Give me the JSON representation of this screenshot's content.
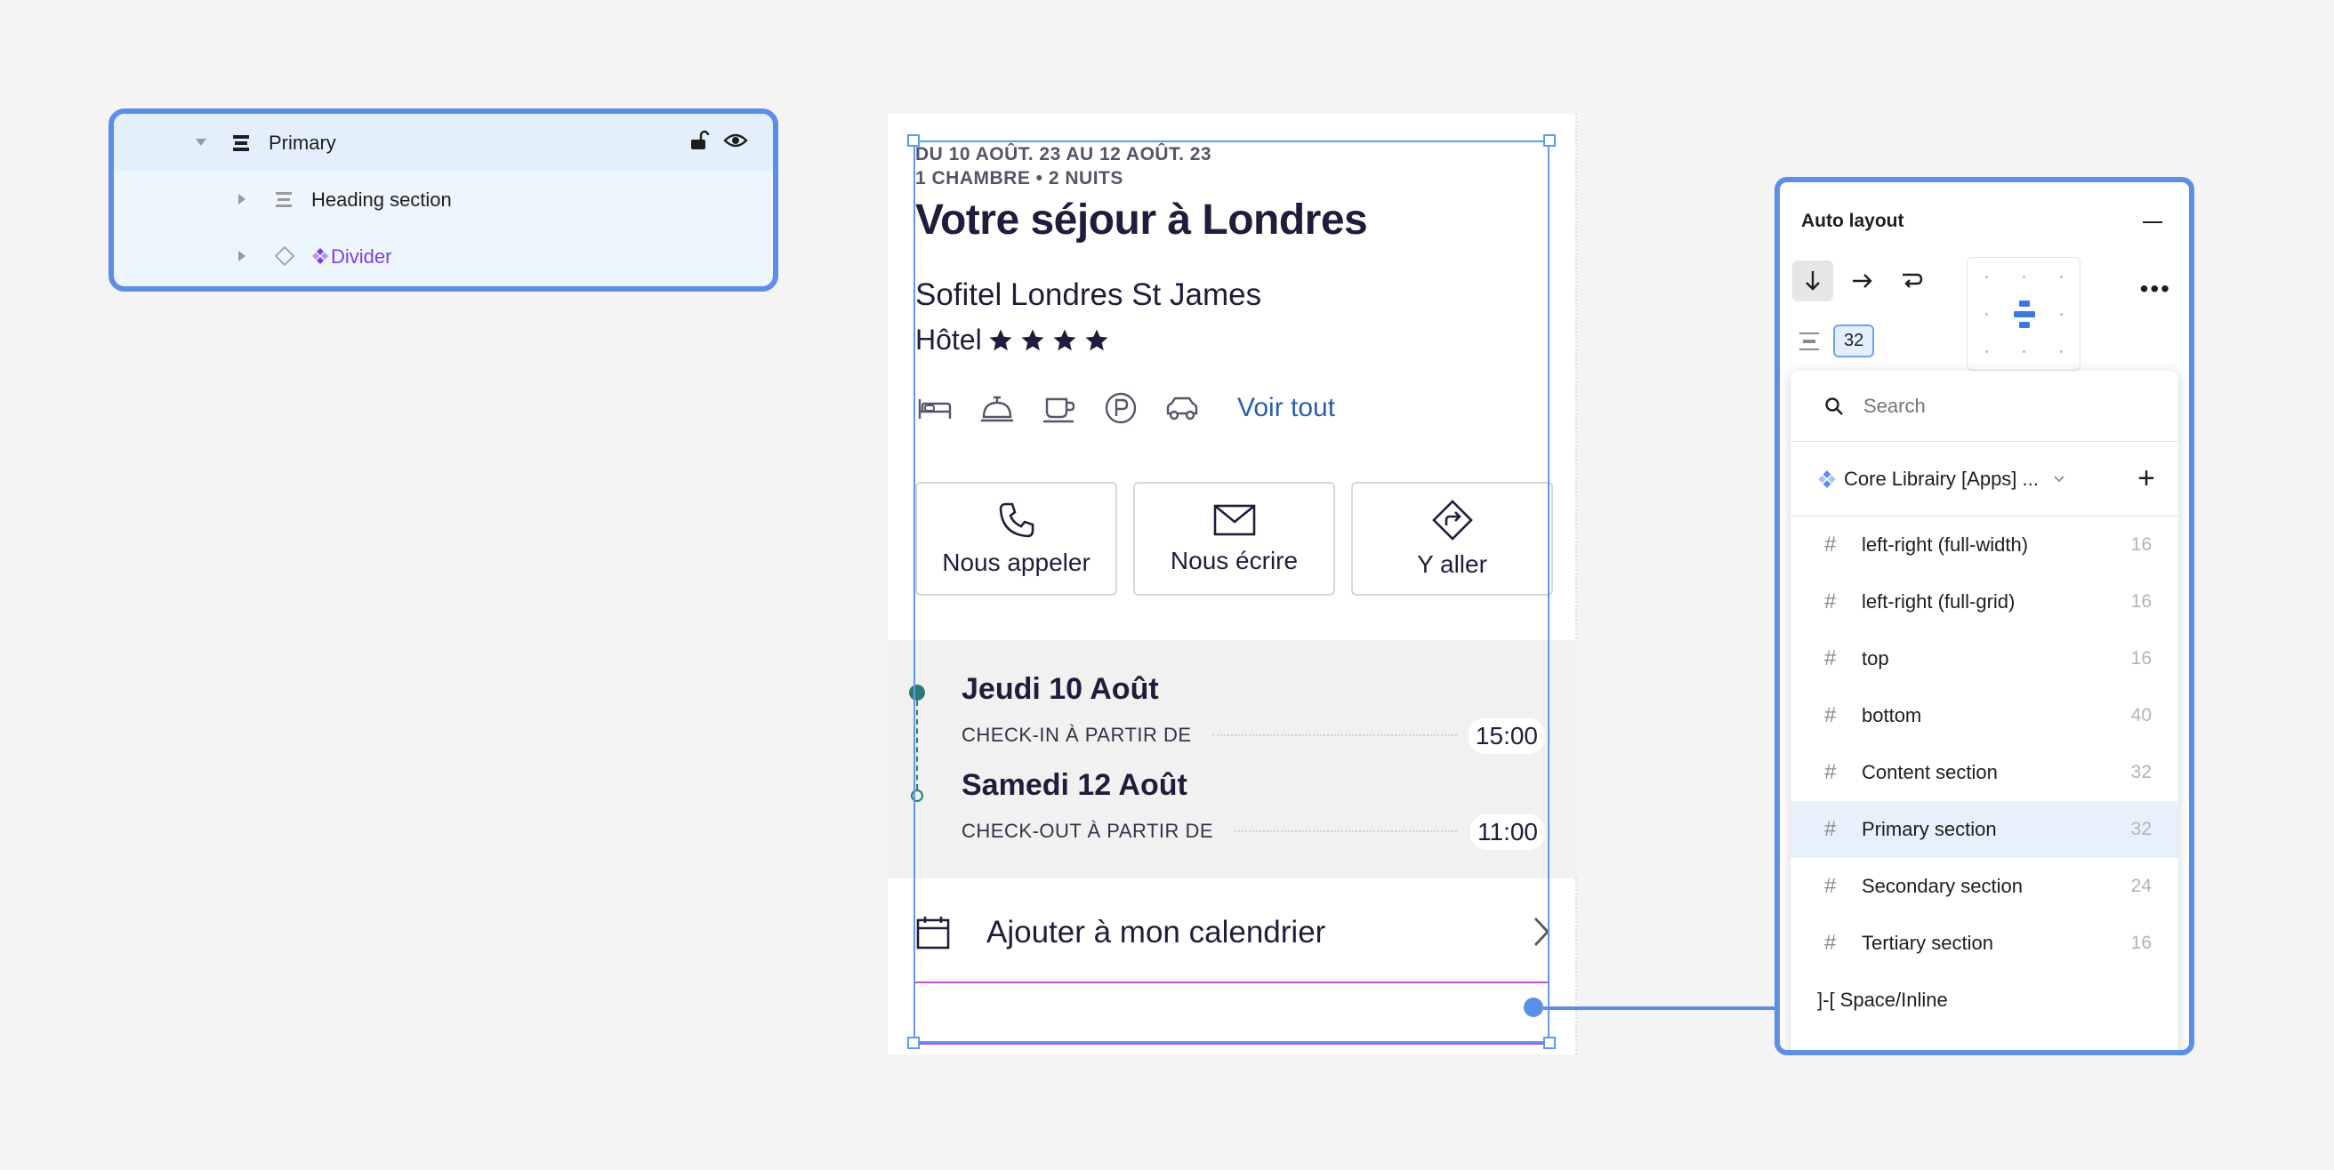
{
  "layers": {
    "items": [
      {
        "label": "Primary"
      },
      {
        "label": "Heading section"
      },
      {
        "label": "Divider"
      }
    ]
  },
  "phone": {
    "dates_line1": "DU 10 AOÛT. 23 AU 12 AOÛT. 23",
    "dates_line2": "1 CHAMBRE • 2 NUITS",
    "title": "Votre séjour à Londres",
    "hotel_name": "Sofitel Londres St James",
    "hotel_type": "Hôtel",
    "star_count": 4,
    "voir_tout": "Voir tout",
    "actions": [
      {
        "label": "Nous appeler"
      },
      {
        "label": "Nous écrire"
      },
      {
        "label": "Y aller"
      }
    ],
    "checkin": {
      "day": "Jeudi 10 Août",
      "label": "CHECK-IN À PARTIR DE",
      "time": "15:00"
    },
    "checkout": {
      "day": "Samedi 12 Août",
      "label": "CHECK-OUT À PARTIR DE",
      "time": "11:00"
    },
    "calendar_label": "Ajouter à mon calendrier"
  },
  "autolayout": {
    "title": "Auto layout",
    "spacing": "32",
    "search_placeholder": "Search",
    "library": "Core Librairy [Apps] ...",
    "items": [
      {
        "label": "left-right (full-width)",
        "value": "16"
      },
      {
        "label": "left-right (full-grid)",
        "value": "16"
      },
      {
        "label": "top",
        "value": "16"
      },
      {
        "label": "bottom",
        "value": "40"
      },
      {
        "label": "Content section",
        "value": "32"
      },
      {
        "label": "Primary section",
        "value": "32",
        "selected": true
      },
      {
        "label": "Secondary section",
        "value": "24"
      },
      {
        "label": "Tertiary section",
        "value": "16"
      }
    ],
    "space_inline": "]-[ Space/Inline"
  },
  "colors": {
    "accent": "#5d8ee8",
    "teal": "#2f7a77",
    "link": "#2a5fa8",
    "component": "#7b3fe4",
    "divider_selection": "#c24fd1"
  }
}
